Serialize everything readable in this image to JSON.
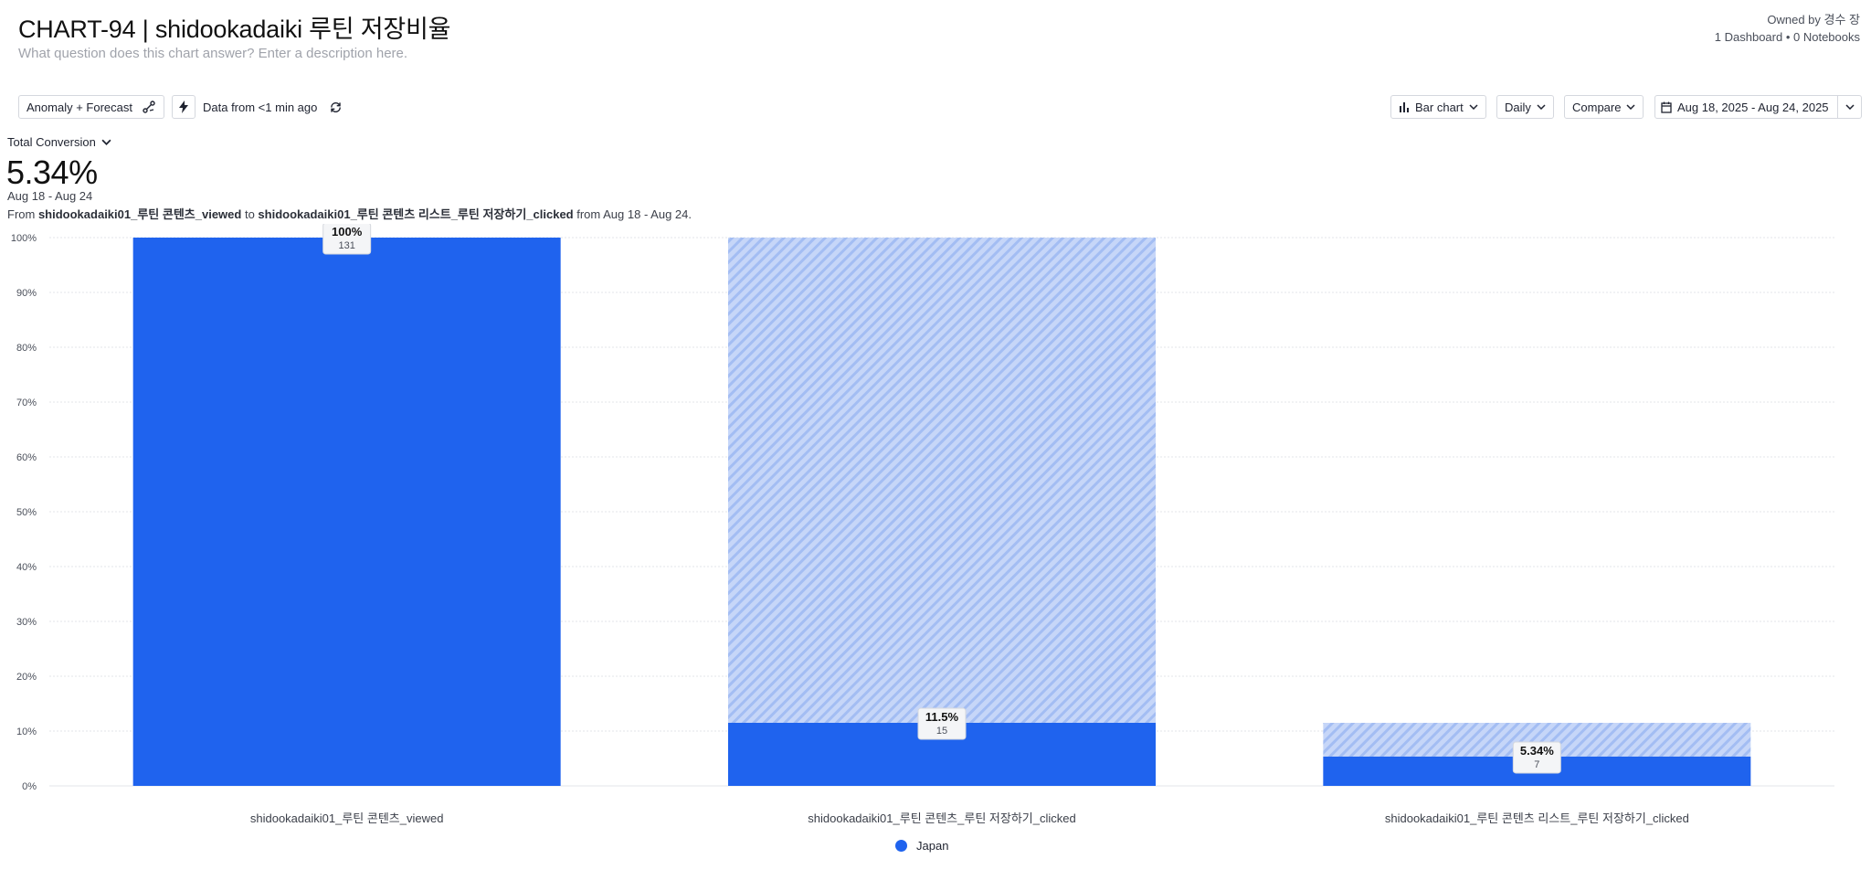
{
  "header": {
    "title": "CHART-94 | shidookadaiki 루틴 저장비율",
    "description_placeholder": "What question does this chart answer? Enter a description here.",
    "owner": "Owned by 경수 장",
    "counts": "1 Dashboard • 0 Notebooks"
  },
  "toolbar": {
    "anomaly_label": "Anomaly + Forecast",
    "freshness_label": "Data from <1 min ago",
    "chart_type_label": "Bar chart",
    "interval_label": "Daily",
    "compare_label": "Compare",
    "date_range_label": "Aug 18, 2025 - Aug 24, 2025"
  },
  "summary": {
    "metric_label": "Total Conversion",
    "value": "5.34%",
    "range": "Aug 18 - Aug 24",
    "desc_prefix": "From ",
    "desc_from_event": "shidookadaiki01_루틴 콘텐츠_viewed",
    "desc_mid": " to ",
    "desc_to_event": "shidookadaiki01_루틴 콘텐츠 리스트_루틴 저장하기_clicked",
    "desc_suffix": " from Aug 18 - Aug 24."
  },
  "colors": {
    "bar": "#1f63ee",
    "dropoff": "#c6d6f8",
    "dropoff_stripe": "#a3bdf3",
    "grid": "#e3e5e9"
  },
  "chart_data": {
    "type": "bar",
    "categories": [
      "shidookadaiki01_루틴 콘텐츠_viewed",
      "shidookadaiki01_루틴 콘텐츠_루틴 저장하기_clicked",
      "shidookadaiki01_루틴 콘텐츠 리스트_루틴 저장하기_clicked"
    ],
    "series": [
      {
        "name": "Japan",
        "values": [
          100,
          11.5,
          5.34
        ],
        "counts": [
          131,
          15,
          7
        ]
      }
    ],
    "dropoff_from": [
      null,
      100,
      11.5
    ],
    "value_labels": [
      "100%",
      "11.5%",
      "5.34%"
    ],
    "count_labels": [
      "131",
      "15",
      "7"
    ],
    "yticks": [
      "0%",
      "10%",
      "20%",
      "30%",
      "40%",
      "50%",
      "60%",
      "70%",
      "80%",
      "90%",
      "100%"
    ],
    "ylim": [
      0,
      100
    ],
    "grid": true,
    "legend": "bottom-center"
  }
}
